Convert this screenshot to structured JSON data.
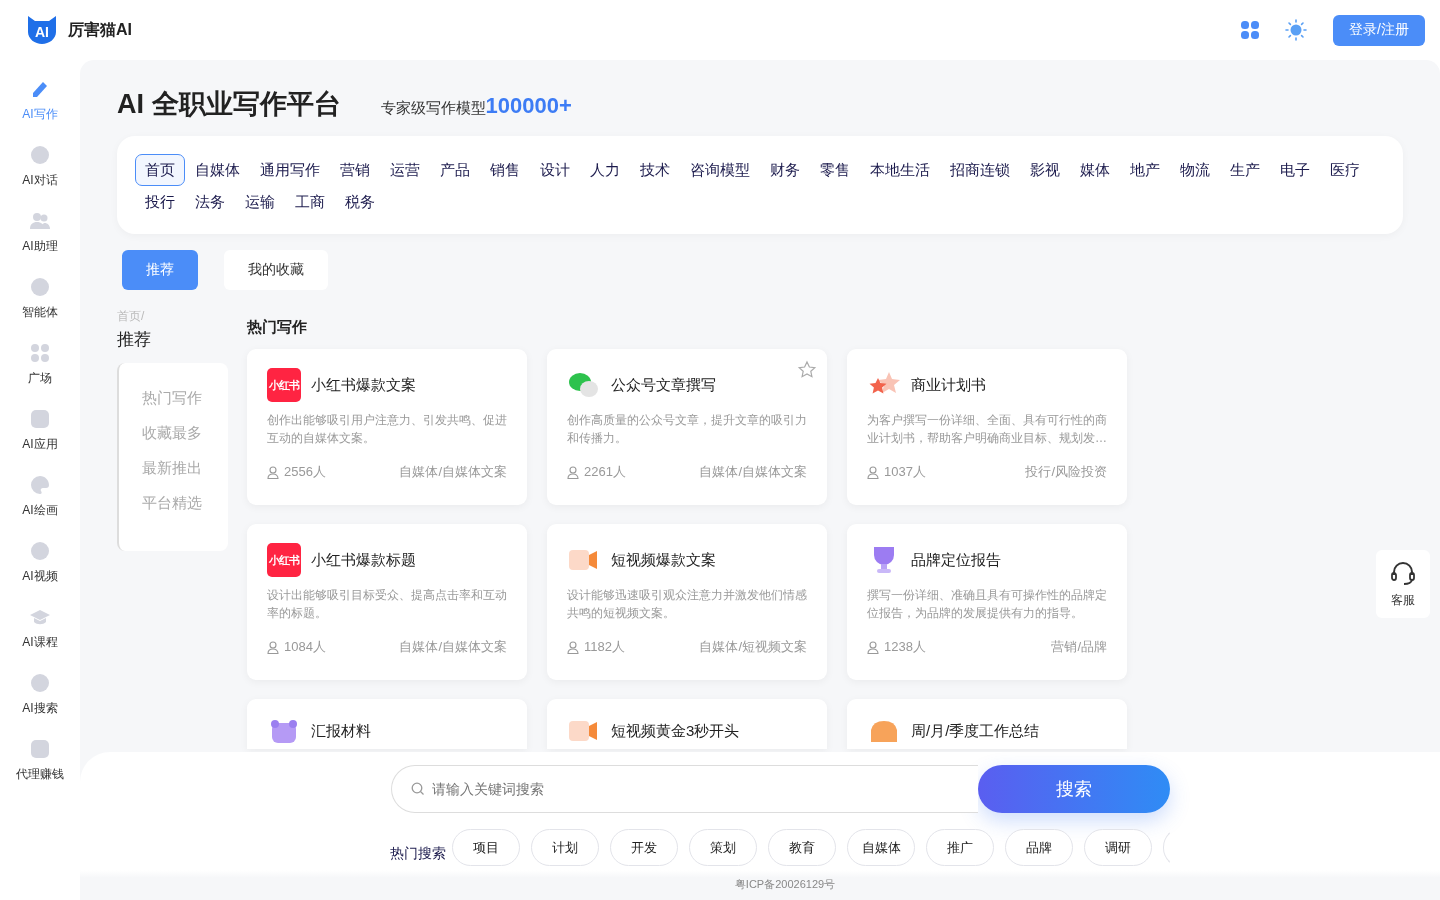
{
  "header": {
    "logo_text": "AI",
    "brand": "厉害猫AI",
    "login_button": "登录/注册"
  },
  "sidebar": {
    "items": [
      {
        "label": "AI写作",
        "selected": true
      },
      {
        "label": "AI对话",
        "selected": false
      },
      {
        "label": "AI助理",
        "selected": false
      },
      {
        "label": "智能体",
        "selected": false
      },
      {
        "label": "广场",
        "selected": false
      },
      {
        "label": "AI应用",
        "selected": false
      },
      {
        "label": "AI绘画",
        "selected": false
      },
      {
        "label": "AI视频",
        "selected": false
      },
      {
        "label": "AI课程",
        "selected": false
      },
      {
        "label": "AI搜索",
        "selected": false
      },
      {
        "label": "代理赚钱",
        "selected": false
      }
    ]
  },
  "hero": {
    "title": "AI 全职业写作平台",
    "subtitle": "专家级写作模型",
    "highlight": "100000+"
  },
  "categories": [
    {
      "label": "首页",
      "selected": true
    },
    {
      "label": "自媒体",
      "selected": false
    },
    {
      "label": "通用写作",
      "selected": false
    },
    {
      "label": "营销",
      "selected": false
    },
    {
      "label": "运营",
      "selected": false
    },
    {
      "label": "产品",
      "selected": false
    },
    {
      "label": "销售",
      "selected": false
    },
    {
      "label": "设计",
      "selected": false
    },
    {
      "label": "人力",
      "selected": false
    },
    {
      "label": "技术",
      "selected": false
    },
    {
      "label": "咨询模型",
      "selected": false
    },
    {
      "label": "财务",
      "selected": false
    },
    {
      "label": "零售",
      "selected": false
    },
    {
      "label": "本地生活",
      "selected": false
    },
    {
      "label": "招商连锁",
      "selected": false
    },
    {
      "label": "影视",
      "selected": false
    },
    {
      "label": "媒体",
      "selected": false
    },
    {
      "label": "地产",
      "selected": false
    },
    {
      "label": "物流",
      "selected": false
    },
    {
      "label": "生产",
      "selected": false
    },
    {
      "label": "电子",
      "selected": false
    },
    {
      "label": "医疗",
      "selected": false
    },
    {
      "label": "投行",
      "selected": false
    },
    {
      "label": "法务",
      "selected": false
    },
    {
      "label": "运输",
      "selected": false
    },
    {
      "label": "工商",
      "selected": false
    },
    {
      "label": "税务",
      "selected": false
    }
  ],
  "tabs": [
    {
      "label": "推荐",
      "selected": true
    },
    {
      "label": "我的收藏",
      "selected": false
    }
  ],
  "breadcrumb": {
    "parent": "首页/",
    "current": "推荐"
  },
  "subnav": [
    "热门写作",
    "收藏最多",
    "最新推出",
    "平台精选"
  ],
  "section_title": "热门写作",
  "cards": [
    {
      "kind": "xhs",
      "logo_text": "小红书",
      "title": "小红书爆款文案",
      "desc": "创作出能够吸引用户注意力、引发共鸣、促进互动的自媒体文案。",
      "users": "2556人",
      "tag": "自媒体/自媒体文案",
      "favorite": false
    },
    {
      "kind": "wechat",
      "title": "公众号文章撰写",
      "desc": "创作高质量的公众号文章，提升文章的吸引力和传播力。",
      "users": "2261人",
      "tag": "自媒体/自媒体文案",
      "favorite": true
    },
    {
      "kind": "stars",
      "title": "商业计划书",
      "desc": "为客户撰写一份详细、全面、具有可行性的商业计划书，帮助客户明确商业目标、规划发…",
      "users": "1037人",
      "tag": "投行/风险投资",
      "favorite": false
    },
    {
      "kind": "xhs",
      "logo_text": "小红书",
      "title": "小红书爆款标题",
      "desc": "设计出能够吸引目标受众、提高点击率和互动率的标题。",
      "users": "1084人",
      "tag": "自媒体/自媒体文案",
      "favorite": false
    },
    {
      "kind": "video",
      "title": "短视频爆款文案",
      "desc": "设计能够迅速吸引观众注意力并激发他们情感共鸣的短视频文案。",
      "users": "1182人",
      "tag": "自媒体/短视频文案",
      "favorite": false
    },
    {
      "kind": "trophy",
      "title": "品牌定位报告",
      "desc": "撰写一份详细、准确且具有可操作性的品牌定位报告，为品牌的发展提供有力的指导。",
      "users": "1238人",
      "tag": "营销/品牌",
      "favorite": false
    }
  ],
  "cards_partial": [
    {
      "kind": "calendar",
      "title": "汇报材料"
    },
    {
      "kind": "video",
      "title": "短视频黄金3秒开头"
    },
    {
      "kind": "box",
      "title": "周/月/季度工作总结"
    }
  ],
  "search": {
    "placeholder": "请输入关键词搜索",
    "button": "搜索",
    "hot_label": "热门搜索",
    "hot": [
      "项目",
      "计划",
      "开发",
      "策划",
      "教育",
      "自媒体",
      "推广",
      "品牌",
      "调研"
    ]
  },
  "footer": "粤ICP备20026129号",
  "support": {
    "label": "客服"
  }
}
